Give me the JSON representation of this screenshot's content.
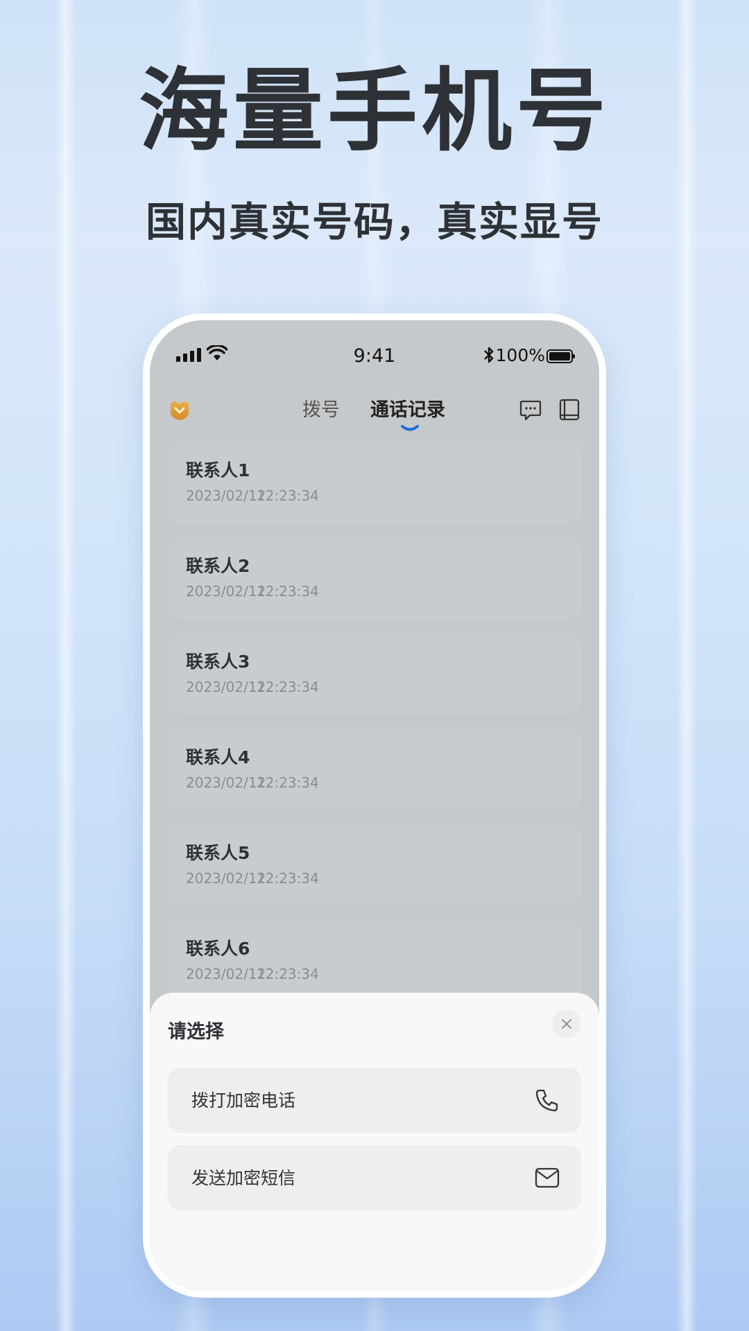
{
  "promo": {
    "headline": "海量手机号",
    "subline": "国内真实号码，真实显号"
  },
  "status_bar": {
    "time": "9:41",
    "battery": "100%"
  },
  "nav": {
    "tabs": [
      {
        "label": "拨号",
        "active": false
      },
      {
        "label": "通话记录",
        "active": true
      }
    ],
    "icons": [
      "shield-icon",
      "message-icon",
      "contacts-book-icon"
    ],
    "accent": "#1a6ed8"
  },
  "call_log": [
    {
      "name": "联系人1",
      "date": "2023/02/12",
      "time": "12:23:34"
    },
    {
      "name": "联系人2",
      "date": "2023/02/12",
      "time": "12:23:34"
    },
    {
      "name": "联系人3",
      "date": "2023/02/12",
      "time": "12:23:34"
    },
    {
      "name": "联系人4",
      "date": "2023/02/12",
      "time": "12:23:34"
    },
    {
      "name": "联系人5",
      "date": "2023/02/12",
      "time": "12:23:34"
    },
    {
      "name": "联系人6",
      "date": "2023/02/12",
      "time": "12:23:34"
    }
  ],
  "sheet": {
    "title": "请选择",
    "options": [
      {
        "label": "拨打加密电话",
        "icon": "phone-icon"
      },
      {
        "label": "发送加密短信",
        "icon": "mail-icon"
      }
    ]
  }
}
